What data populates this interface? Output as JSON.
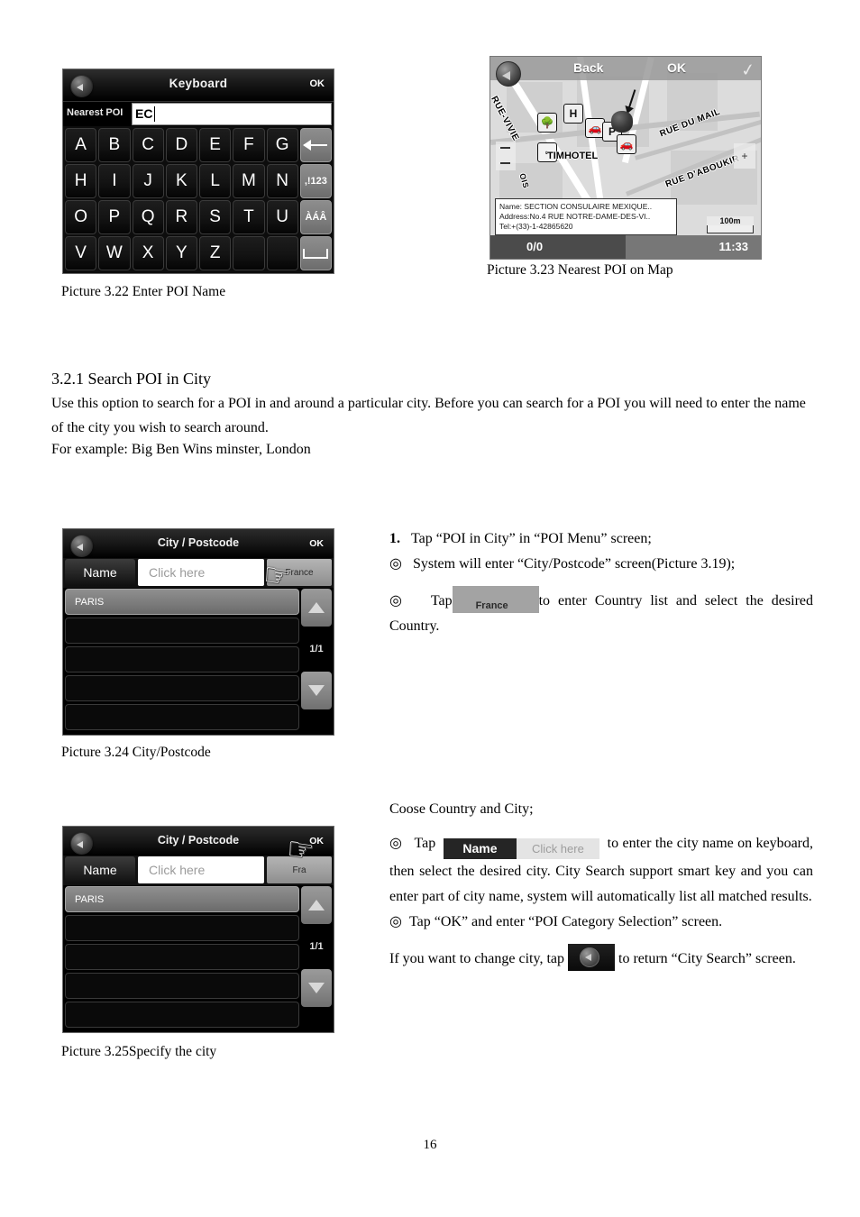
{
  "page": {
    "number": "16"
  },
  "keyboard_screen": {
    "title": "Keyboard",
    "ok_label": "OK",
    "back_icon": "back-arrow-icon",
    "field_prefix": "Nearest POI",
    "field_value": "EC",
    "rows": [
      [
        "A",
        "B",
        "C",
        "D",
        "E",
        "F",
        "G"
      ],
      [
        "H",
        "I",
        "J",
        "K",
        "L",
        "M",
        "N"
      ],
      [
        "O",
        "P",
        "Q",
        "R",
        "S",
        "T",
        "U"
      ],
      [
        "V",
        "W",
        "X",
        "Y",
        "Z",
        "",
        ""
      ]
    ],
    "function_keys": [
      {
        "name": "backspace-key",
        "label": ""
      },
      {
        "name": "symbols-key",
        "label": ",!123"
      },
      {
        "name": "accents-key",
        "label": "ÀÁÂ"
      },
      {
        "name": "space-key",
        "label": ""
      }
    ],
    "caption": "Picture 3.22 Enter POI Name"
  },
  "map_screen": {
    "back_label": "Back",
    "ok_label": "OK",
    "back_icon": "back-arrow-icon",
    "check_icon": "checkmark-icon",
    "streets": [
      "RUE-VIVIE",
      "RUE DU MAIL",
      "RUE D'ABOUKIR",
      "OIS"
    ],
    "hotel_label": "TIMHOTEL",
    "hotel_icon": "hotel-h-icon",
    "park_icon": "park-tree-icon",
    "info_box": {
      "name_line": "Name:   SECTION CONSULAIRE MEXIQUE..",
      "address_line": "Address:No.4 RUE NOTRE-DAME-DES-VI..",
      "tel_line": "Tel:+(33)-1-42865620"
    },
    "scale_label": "100m",
    "zoom_in_label": "+",
    "status_counter": "0/0",
    "clock": "11:33",
    "caption": "Picture 3.23 Nearest POI on Map"
  },
  "section": {
    "heading": "3.2.1 Search POI in City",
    "paragraph1": "Use this option to search for a POI in and around a particular city. Before you can search for a POI you will need to enter the name of the city you wish to search around.",
    "paragraph2": "For example: Big Ben Wins minster, London"
  },
  "city_screen_1": {
    "title": "City / Postcode",
    "ok_label": "OK",
    "back_icon": "back-arrow-icon",
    "name_button": "Name",
    "input_placeholder": "Click here",
    "country_button": "France",
    "list_items": [
      "PARIS",
      "",
      "",
      "",
      ""
    ],
    "page_indicator": "1/1",
    "scroll_up_icon": "triangle-up-icon",
    "scroll_down_icon": "triangle-down-icon",
    "cursor_icon": "hand-pointer-icon",
    "caption": "Picture 3.24 City/Postcode"
  },
  "city_screen_2": {
    "title": "City / Postcode",
    "ok_label": "OK",
    "back_icon": "back-arrow-icon",
    "name_button": "Name",
    "input_placeholder": "Click here",
    "country_button": "Fra",
    "list_items": [
      "PARIS",
      "",
      "",
      "",
      ""
    ],
    "page_indicator": "1/1",
    "scroll_up_icon": "triangle-up-icon",
    "scroll_down_icon": "triangle-down-icon",
    "cursor_icon": "hand-pointer-icon",
    "caption": "Picture 3.25Specify the city"
  },
  "steps_top": {
    "step1_number": "1.",
    "step1_text": "Tap “POI in City” in “POI Menu” screen;",
    "bullet2_marker": "◎",
    "bullet2_text": "System will enter “City/Postcode” screen(Picture 3.19);",
    "bullet3_marker": "◎",
    "bullet3_prefix": "Tap",
    "bullet3_inline_label": "France",
    "bullet3_suffix": "to enter Country list and select the desired Country."
  },
  "steps_bottom": {
    "intro": "Coose Country and City;",
    "bullet1_marker": "◎",
    "bullet1_prefix": "Tap",
    "inline_name_label": "Name",
    "inline_click_label": "Click here",
    "bullet1_suffix": "to enter the city name on keyboard, then select the desired city. City Search support smart key and you can enter part of city name, system will automatically list all matched results.",
    "bullet2_marker": "◎",
    "bullet2_text": "Tap “OK” and enter “POI Category Selection” screen.",
    "closing_prefix": "If you want to change city, tap",
    "closing_suffix": "to return “City Search” screen."
  }
}
